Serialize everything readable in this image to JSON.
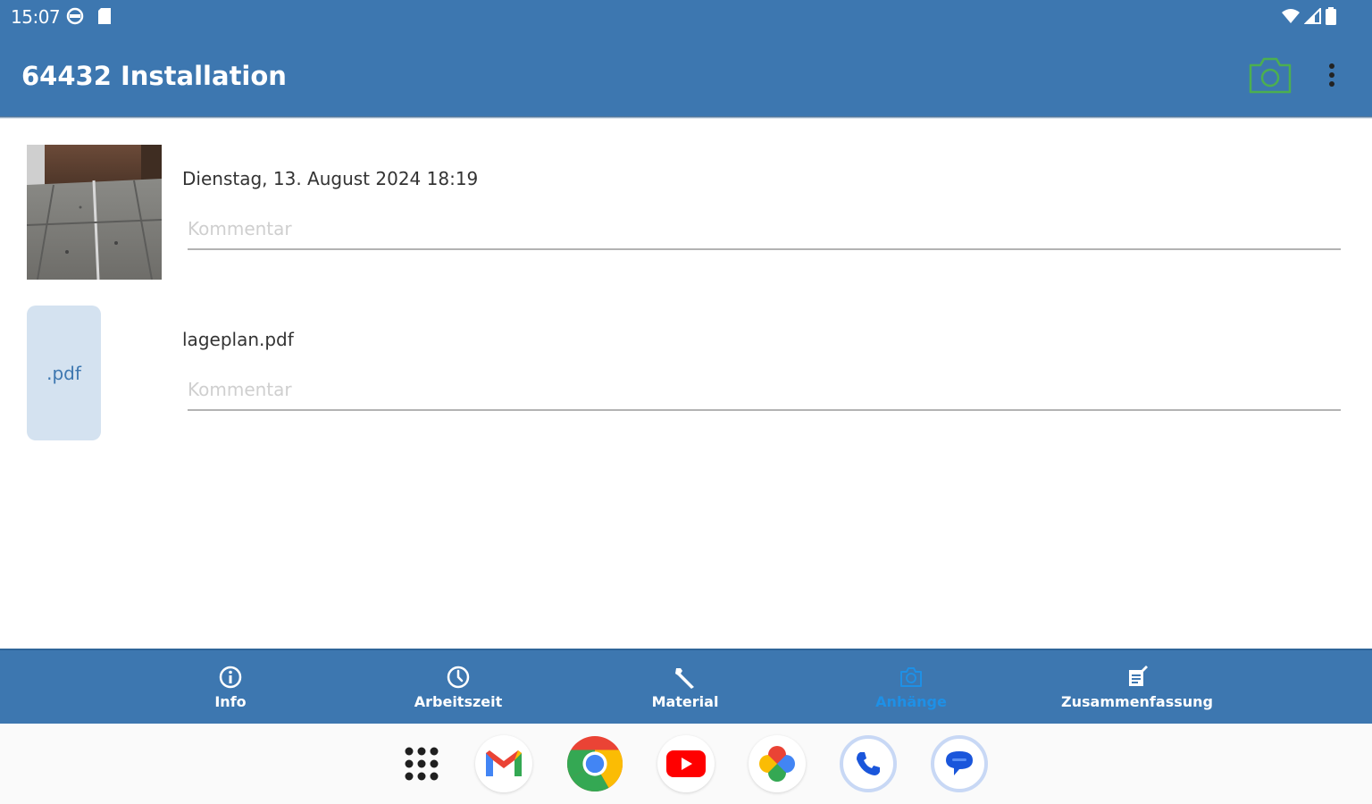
{
  "status_bar": {
    "time": "15:07"
  },
  "app_bar": {
    "title": "64432 Installation"
  },
  "attachments": [
    {
      "type": "photo",
      "title": "Dienstag, 13. August 2024  18:19",
      "comment_value": "",
      "comment_placeholder": "Kommentar"
    },
    {
      "type": "pdf",
      "thumb_label": ".pdf",
      "title": "lageplan.pdf",
      "comment_value": "",
      "comment_placeholder": "Kommentar"
    }
  ],
  "bottom_nav": {
    "items": [
      {
        "label": "Info",
        "icon": "info-icon"
      },
      {
        "label": "Arbeitszeit",
        "icon": "clock-icon"
      },
      {
        "label": "Material",
        "icon": "wrench-icon"
      },
      {
        "label": "Anhänge",
        "icon": "camera-icon",
        "active": true
      },
      {
        "label": "Zusammenfassung",
        "icon": "summary-icon"
      }
    ]
  },
  "colors": {
    "primary": "#3d77b0",
    "accent": "#1e90e6",
    "camera_icon": "#4caf50"
  }
}
